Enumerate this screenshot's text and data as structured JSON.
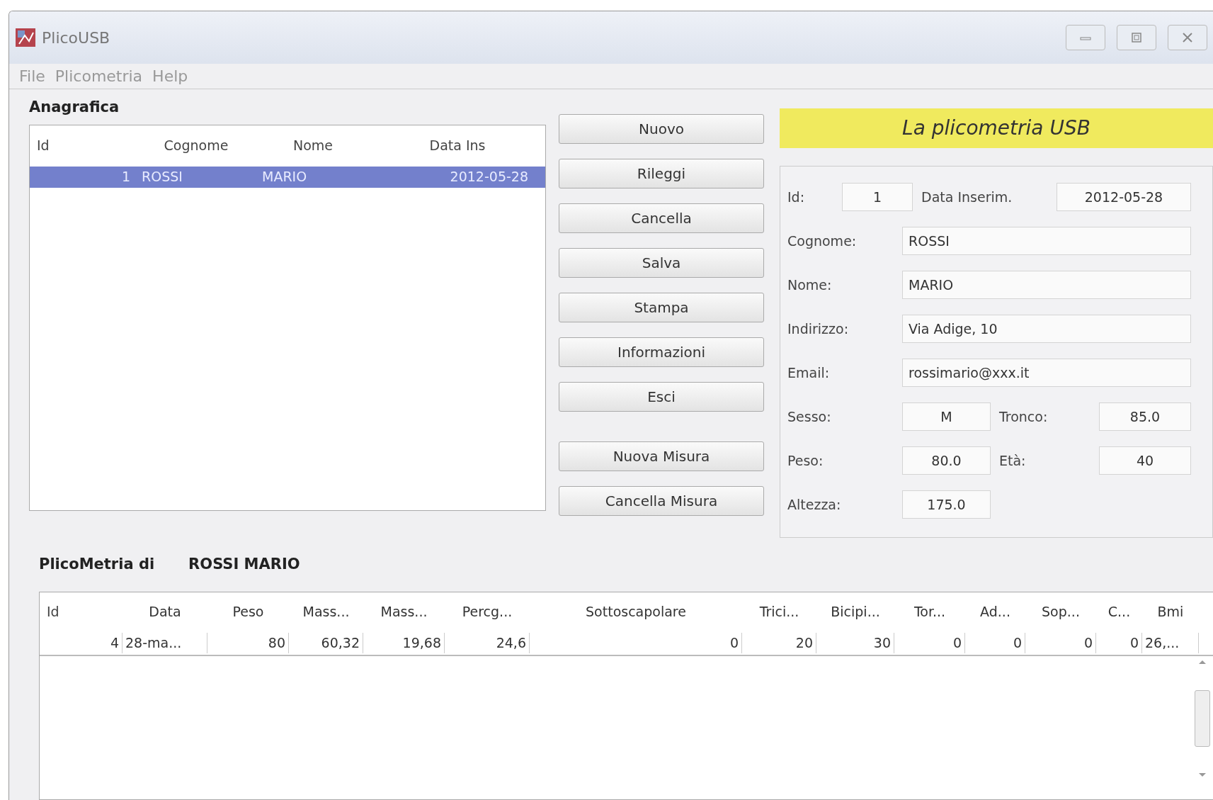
{
  "window": {
    "title": "PlicoUSB"
  },
  "menu": [
    "File",
    "Plicometria",
    "Help"
  ],
  "anagrafica": {
    "title": "Anagrafica",
    "columns": [
      "Id",
      "Cognome",
      "Nome",
      "Data Ins"
    ],
    "rows": [
      {
        "cells": [
          "1",
          "ROSSI",
          "MARIO",
          "2012-05-28"
        ],
        "selected": true
      }
    ]
  },
  "buttons": [
    "Nuovo",
    "Rileggi",
    "Cancella",
    "Salva",
    "Stampa",
    "Informazioni",
    "Esci"
  ],
  "measure_buttons": [
    "Nuova Misura",
    "Cancella Misura"
  ],
  "banner": "La plicometria USB",
  "form": {
    "rows": [
      [
        {
          "label": "Id:",
          "value": "1"
        },
        {
          "label": "Data Inserim.",
          "value": "2012-05-28"
        }
      ],
      [
        {
          "label": "Cognome:",
          "value": "ROSSI"
        }
      ],
      [
        {
          "label": "Nome:",
          "value": "MARIO"
        }
      ],
      [
        {
          "label": "Indirizzo:",
          "value": "Via Adige, 10"
        }
      ],
      [
        {
          "label": "Email:",
          "value": "rossimario@xxx.it"
        }
      ],
      [
        {
          "label": "Sesso:",
          "value": "M"
        },
        {
          "label": "Tronco:",
          "value": "85.0"
        }
      ],
      [
        {
          "label": "Peso:",
          "value": "80.0"
        },
        {
          "label": "Età:",
          "value": "40"
        }
      ],
      [
        {
          "label": "Altezza:",
          "value": "175.0"
        }
      ]
    ]
  },
  "plicometria": {
    "label": "PlicoMetria di",
    "person": "ROSSI MARIO",
    "columns": [
      "Id",
      "Data",
      "Peso",
      "Mass...",
      "Mass...",
      "Percg...",
      "Sottoscapolare",
      "Trici...",
      "Bicipi...",
      "Tor...",
      "Ad...",
      "Sop...",
      "C...",
      "Bmi"
    ],
    "rows": [
      {
        "cells": [
          "4",
          "28-ma...",
          "80",
          "60,32",
          "19,68",
          "24,6",
          "0",
          "20",
          "30",
          "0",
          "0",
          "0",
          "0",
          "26,..."
        ],
        "selected": false
      }
    ]
  }
}
